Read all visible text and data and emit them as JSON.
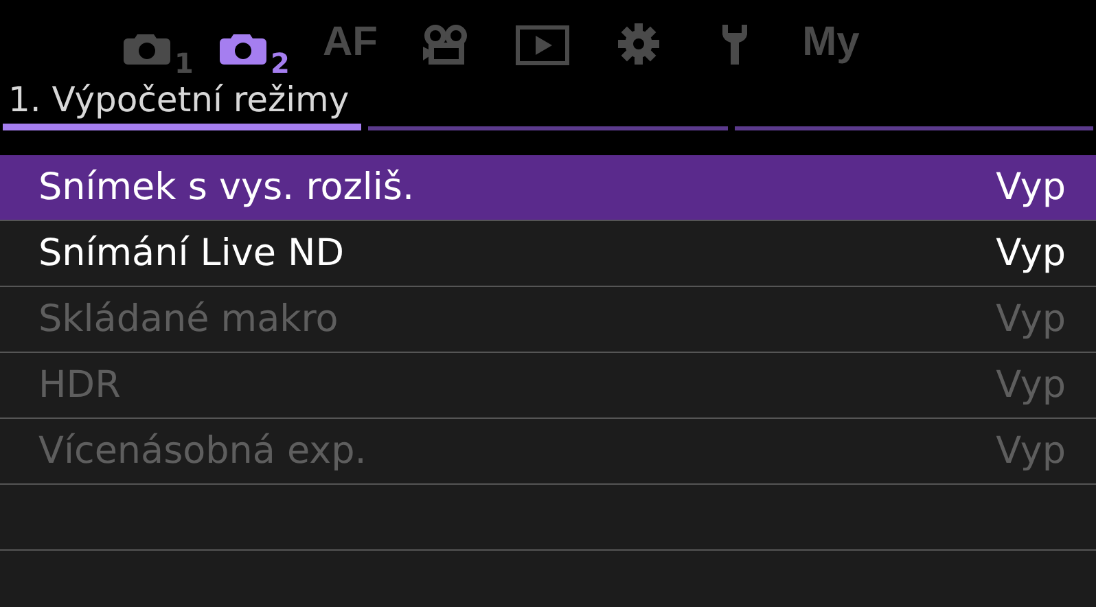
{
  "tabs": [
    {
      "kind": "camera",
      "label": "1",
      "selected": false
    },
    {
      "kind": "camera",
      "label": "2",
      "selected": true
    },
    {
      "kind": "text",
      "label": "AF",
      "selected": false
    },
    {
      "kind": "video",
      "selected": false
    },
    {
      "kind": "play",
      "selected": false
    },
    {
      "kind": "gear",
      "selected": false
    },
    {
      "kind": "wrench",
      "selected": false
    },
    {
      "kind": "text",
      "label": "My",
      "selected": false
    }
  ],
  "section_title": "1. Výpočetní režimy",
  "pages": [
    {
      "selected": true
    },
    {
      "selected": false
    },
    {
      "selected": false
    }
  ],
  "menu_items": [
    {
      "label": "Snímek s vys. rozliš.",
      "value": "Vyp",
      "selected": true,
      "disabled": false
    },
    {
      "label": "Snímání Live ND",
      "value": "Vyp",
      "selected": false,
      "disabled": false
    },
    {
      "label": "Skládané makro",
      "value": "Vyp",
      "selected": false,
      "disabled": true
    },
    {
      "label": "HDR",
      "value": "Vyp",
      "selected": false,
      "disabled": true
    },
    {
      "label": "Vícenásobná exp.",
      "value": "Vyp",
      "selected": false,
      "disabled": true
    }
  ]
}
